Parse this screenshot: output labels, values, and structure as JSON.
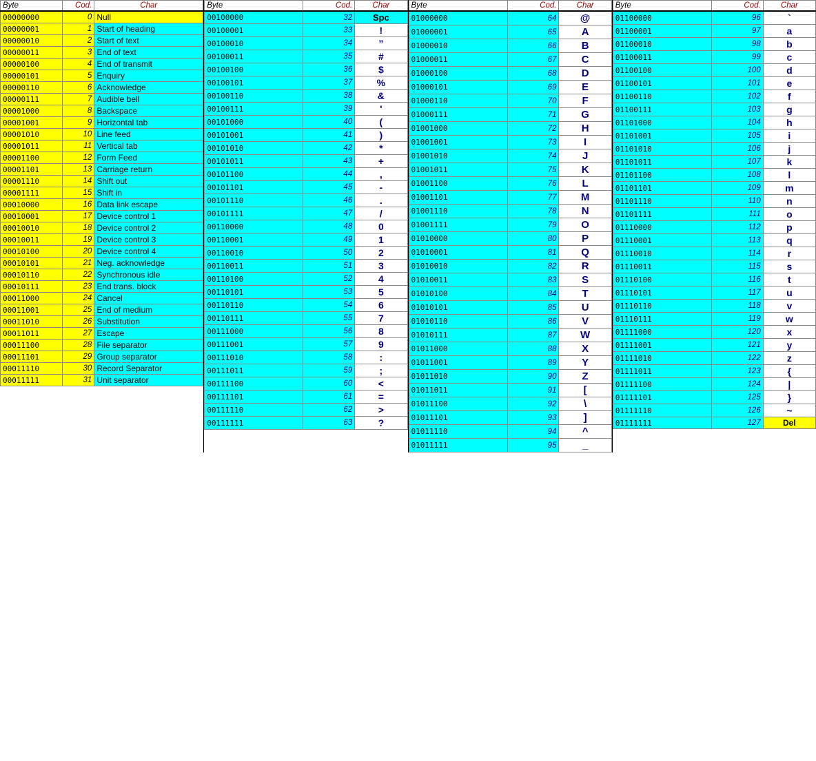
{
  "sections": [
    {
      "id": "section1",
      "headers": [
        "Byte",
        "Cod.",
        "Char"
      ],
      "rows": [
        {
          "byte": "00000000",
          "code": "0",
          "char": "Null",
          "charType": "text",
          "byteColor": "yellow",
          "descColor": "yellow"
        },
        {
          "byte": "00000001",
          "code": "1",
          "char": "Start of heading",
          "charType": "text",
          "byteColor": "yellow",
          "descColor": "cyan"
        },
        {
          "byte": "00000010",
          "code": "2",
          "char": "Start of text",
          "charType": "text",
          "byteColor": "yellow",
          "descColor": "cyan"
        },
        {
          "byte": "00000011",
          "code": "3",
          "char": "End of text",
          "charType": "text",
          "byteColor": "yellow",
          "descColor": "cyan"
        },
        {
          "byte": "00000100",
          "code": "4",
          "char": "End of transmit",
          "charType": "text",
          "byteColor": "yellow",
          "descColor": "cyan"
        },
        {
          "byte": "00000101",
          "code": "5",
          "char": "Enquiry",
          "charType": "text",
          "byteColor": "yellow",
          "descColor": "cyan"
        },
        {
          "byte": "00000110",
          "code": "6",
          "char": "Acknowledge",
          "charType": "text",
          "byteColor": "yellow",
          "descColor": "cyan"
        },
        {
          "byte": "00000111",
          "code": "7",
          "char": "Audible bell",
          "charType": "text",
          "byteColor": "yellow",
          "descColor": "cyan"
        },
        {
          "byte": "00001000",
          "code": "8",
          "char": "Backspace",
          "charType": "text",
          "byteColor": "yellow",
          "descColor": "cyan"
        },
        {
          "byte": "00001001",
          "code": "9",
          "char": "Horizontal tab",
          "charType": "text",
          "byteColor": "yellow",
          "descColor": "cyan"
        },
        {
          "byte": "00001010",
          "code": "10",
          "char": "Line feed",
          "charType": "text",
          "byteColor": "yellow",
          "descColor": "cyan"
        },
        {
          "byte": "00001011",
          "code": "11",
          "char": "Vertical tab",
          "charType": "text",
          "byteColor": "yellow",
          "descColor": "cyan"
        },
        {
          "byte": "00001100",
          "code": "12",
          "char": "Form Feed",
          "charType": "text",
          "byteColor": "yellow",
          "descColor": "cyan"
        },
        {
          "byte": "00001101",
          "code": "13",
          "char": "Carriage return",
          "charType": "text",
          "byteColor": "yellow",
          "descColor": "cyan"
        },
        {
          "byte": "00001110",
          "code": "14",
          "char": "Shift out",
          "charType": "text",
          "byteColor": "yellow",
          "descColor": "cyan"
        },
        {
          "byte": "00001111",
          "code": "15",
          "char": "Shift in",
          "charType": "text",
          "byteColor": "yellow",
          "descColor": "cyan"
        },
        {
          "byte": "00010000",
          "code": "16",
          "char": "Data link escape",
          "charType": "text",
          "byteColor": "yellow",
          "descColor": "cyan"
        },
        {
          "byte": "00010001",
          "code": "17",
          "char": "Device control 1",
          "charType": "text",
          "byteColor": "yellow",
          "descColor": "cyan"
        },
        {
          "byte": "00010010",
          "code": "18",
          "char": "Device control 2",
          "charType": "text",
          "byteColor": "yellow",
          "descColor": "cyan"
        },
        {
          "byte": "00010011",
          "code": "19",
          "char": "Device control 3",
          "charType": "text",
          "byteColor": "yellow",
          "descColor": "cyan"
        },
        {
          "byte": "00010100",
          "code": "20",
          "char": "Device control 4",
          "charType": "text",
          "byteColor": "yellow",
          "descColor": "cyan"
        },
        {
          "byte": "00010101",
          "code": "21",
          "char": "Neg. acknowledge",
          "charType": "text",
          "byteColor": "yellow",
          "descColor": "cyan"
        },
        {
          "byte": "00010110",
          "code": "22",
          "char": "Synchronous idle",
          "charType": "text",
          "byteColor": "yellow",
          "descColor": "cyan"
        },
        {
          "byte": "00010111",
          "code": "23",
          "char": "End trans. block",
          "charType": "text",
          "byteColor": "yellow",
          "descColor": "cyan"
        },
        {
          "byte": "00011000",
          "code": "24",
          "char": "Cancel",
          "charType": "text",
          "byteColor": "yellow",
          "descColor": "cyan"
        },
        {
          "byte": "00011001",
          "code": "25",
          "char": "End of medium",
          "charType": "text",
          "byteColor": "yellow",
          "descColor": "cyan"
        },
        {
          "byte": "00011010",
          "code": "26",
          "char": "Substitution",
          "charType": "text",
          "byteColor": "yellow",
          "descColor": "cyan"
        },
        {
          "byte": "00011011",
          "code": "27",
          "char": "Escape",
          "charType": "text",
          "byteColor": "yellow",
          "descColor": "cyan"
        },
        {
          "byte": "00011100",
          "code": "28",
          "char": "File separator",
          "charType": "text",
          "byteColor": "yellow",
          "descColor": "cyan"
        },
        {
          "byte": "00011101",
          "code": "29",
          "char": "Group separator",
          "charType": "text",
          "byteColor": "yellow",
          "descColor": "cyan"
        },
        {
          "byte": "00011110",
          "code": "30",
          "char": "Record Separator",
          "charType": "text",
          "byteColor": "yellow",
          "descColor": "cyan"
        },
        {
          "byte": "00011111",
          "code": "31",
          "char": "Unit separator",
          "charType": "text",
          "byteColor": "yellow",
          "descColor": "cyan"
        }
      ]
    },
    {
      "id": "section2",
      "headers": [
        "Byte",
        "Cod.",
        "Char"
      ],
      "rows": [
        {
          "byte": "00100000",
          "code": "32",
          "char": "Spc",
          "charType": "symbol",
          "byteColor": "cyan",
          "descColor": "cyan"
        },
        {
          "byte": "00100001",
          "code": "33",
          "char": "!",
          "charType": "symbol"
        },
        {
          "byte": "00100010",
          "code": "34",
          "char": "”",
          "charType": "symbol"
        },
        {
          "byte": "00100011",
          "code": "35",
          "char": "#",
          "charType": "symbol"
        },
        {
          "byte": "00100100",
          "code": "36",
          "char": "$",
          "charType": "symbol"
        },
        {
          "byte": "00100101",
          "code": "37",
          "char": "%",
          "charType": "symbol"
        },
        {
          "byte": "00100110",
          "code": "38",
          "char": "&",
          "charType": "symbol"
        },
        {
          "byte": "00100111",
          "code": "39",
          "char": "'",
          "charType": "symbol"
        },
        {
          "byte": "00101000",
          "code": "40",
          "char": "(",
          "charType": "symbol"
        },
        {
          "byte": "00101001",
          "code": "41",
          "char": ")",
          "charType": "symbol"
        },
        {
          "byte": "00101010",
          "code": "42",
          "char": "*",
          "charType": "symbol"
        },
        {
          "byte": "00101011",
          "code": "43",
          "char": "+",
          "charType": "symbol"
        },
        {
          "byte": "00101100",
          "code": "44",
          "char": ",",
          "charType": "symbol"
        },
        {
          "byte": "00101101",
          "code": "45",
          "char": "-",
          "charType": "symbol"
        },
        {
          "byte": "00101110",
          "code": "46",
          "char": ".",
          "charType": "symbol"
        },
        {
          "byte": "00101111",
          "code": "47",
          "char": "/",
          "charType": "symbol"
        },
        {
          "byte": "00110000",
          "code": "48",
          "char": "0",
          "charType": "symbol"
        },
        {
          "byte": "00110001",
          "code": "49",
          "char": "1",
          "charType": "symbol"
        },
        {
          "byte": "00110010",
          "code": "50",
          "char": "2",
          "charType": "symbol"
        },
        {
          "byte": "00110011",
          "code": "51",
          "char": "3",
          "charType": "symbol"
        },
        {
          "byte": "00110100",
          "code": "52",
          "char": "4",
          "charType": "symbol"
        },
        {
          "byte": "00110101",
          "code": "53",
          "char": "5",
          "charType": "symbol"
        },
        {
          "byte": "00110110",
          "code": "54",
          "char": "6",
          "charType": "symbol"
        },
        {
          "byte": "00110111",
          "code": "55",
          "char": "7",
          "charType": "symbol"
        },
        {
          "byte": "00111000",
          "code": "56",
          "char": "8",
          "charType": "symbol"
        },
        {
          "byte": "00111001",
          "code": "57",
          "char": "9",
          "charType": "symbol"
        },
        {
          "byte": "00111010",
          "code": "58",
          "char": ":",
          "charType": "symbol"
        },
        {
          "byte": "00111011",
          "code": "59",
          "char": ";",
          "charType": "symbol"
        },
        {
          "byte": "00111100",
          "code": "60",
          "char": "<",
          "charType": "symbol"
        },
        {
          "byte": "00111101",
          "code": "61",
          "char": "=",
          "charType": "symbol"
        },
        {
          "byte": "00111110",
          "code": "62",
          "char": ">",
          "charType": "symbol"
        },
        {
          "byte": "00111111",
          "code": "63",
          "char": "?",
          "charType": "symbol"
        }
      ]
    },
    {
      "id": "section3",
      "headers": [
        "Byte",
        "Cod.",
        "Char"
      ],
      "rows": [
        {
          "byte": "01000000",
          "code": "64",
          "char": "@"
        },
        {
          "byte": "01000001",
          "code": "65",
          "char": "A"
        },
        {
          "byte": "01000010",
          "code": "66",
          "char": "B"
        },
        {
          "byte": "01000011",
          "code": "67",
          "char": "C"
        },
        {
          "byte": "01000100",
          "code": "68",
          "char": "D"
        },
        {
          "byte": "01000101",
          "code": "69",
          "char": "E"
        },
        {
          "byte": "01000110",
          "code": "70",
          "char": "F"
        },
        {
          "byte": "01000111",
          "code": "71",
          "char": "G"
        },
        {
          "byte": "01001000",
          "code": "72",
          "char": "H"
        },
        {
          "byte": "01001001",
          "code": "73",
          "char": "I"
        },
        {
          "byte": "01001010",
          "code": "74",
          "char": "J"
        },
        {
          "byte": "01001011",
          "code": "75",
          "char": "K"
        },
        {
          "byte": "01001100",
          "code": "76",
          "char": "L"
        },
        {
          "byte": "01001101",
          "code": "77",
          "char": "M"
        },
        {
          "byte": "01001110",
          "code": "78",
          "char": "N"
        },
        {
          "byte": "01001111",
          "code": "79",
          "char": "O"
        },
        {
          "byte": "01010000",
          "code": "80",
          "char": "P"
        },
        {
          "byte": "01010001",
          "code": "81",
          "char": "Q"
        },
        {
          "byte": "01010010",
          "code": "82",
          "char": "R"
        },
        {
          "byte": "01010011",
          "code": "83",
          "char": "S"
        },
        {
          "byte": "01010100",
          "code": "84",
          "char": "T"
        },
        {
          "byte": "01010101",
          "code": "85",
          "char": "U"
        },
        {
          "byte": "01010110",
          "code": "86",
          "char": "V"
        },
        {
          "byte": "01010111",
          "code": "87",
          "char": "W"
        },
        {
          "byte": "01011000",
          "code": "88",
          "char": "X"
        },
        {
          "byte": "01011001",
          "code": "89",
          "char": "Y"
        },
        {
          "byte": "01011010",
          "code": "90",
          "char": "Z"
        },
        {
          "byte": "01011011",
          "code": "91",
          "char": "["
        },
        {
          "byte": "01011100",
          "code": "92",
          "char": "\\"
        },
        {
          "byte": "01011101",
          "code": "93",
          "char": "]"
        },
        {
          "byte": "01011110",
          "code": "94",
          "char": "^"
        },
        {
          "byte": "01011111",
          "code": "95",
          "char": "_"
        }
      ]
    },
    {
      "id": "section4",
      "headers": [
        "Byte",
        "Cod.",
        "Char"
      ],
      "rows": [
        {
          "byte": "01100000",
          "code": "96",
          "char": "`"
        },
        {
          "byte": "01100001",
          "code": "97",
          "char": "a"
        },
        {
          "byte": "01100010",
          "code": "98",
          "char": "b"
        },
        {
          "byte": "01100011",
          "code": "99",
          "char": "c"
        },
        {
          "byte": "01100100",
          "code": "100",
          "char": "d"
        },
        {
          "byte": "01100101",
          "code": "101",
          "char": "e"
        },
        {
          "byte": "01100110",
          "code": "102",
          "char": "f"
        },
        {
          "byte": "01100111",
          "code": "103",
          "char": "g"
        },
        {
          "byte": "01101000",
          "code": "104",
          "char": "h"
        },
        {
          "byte": "01101001",
          "code": "105",
          "char": "i"
        },
        {
          "byte": "01101010",
          "code": "106",
          "char": "j"
        },
        {
          "byte": "01101011",
          "code": "107",
          "char": "k"
        },
        {
          "byte": "01101100",
          "code": "108",
          "char": "l"
        },
        {
          "byte": "01101101",
          "code": "109",
          "char": "m"
        },
        {
          "byte": "01101110",
          "code": "110",
          "char": "n"
        },
        {
          "byte": "01101111",
          "code": "111",
          "char": "o"
        },
        {
          "byte": "01110000",
          "code": "112",
          "char": "p"
        },
        {
          "byte": "01110001",
          "code": "113",
          "char": "q"
        },
        {
          "byte": "01110010",
          "code": "114",
          "char": "r"
        },
        {
          "byte": "01110011",
          "code": "115",
          "char": "s"
        },
        {
          "byte": "01110100",
          "code": "116",
          "char": "t"
        },
        {
          "byte": "01110101",
          "code": "117",
          "char": "u"
        },
        {
          "byte": "01110110",
          "code": "118",
          "char": "v"
        },
        {
          "byte": "01110111",
          "code": "119",
          "char": "w"
        },
        {
          "byte": "01111000",
          "code": "120",
          "char": "x"
        },
        {
          "byte": "01111001",
          "code": "121",
          "char": "y"
        },
        {
          "byte": "01111010",
          "code": "122",
          "char": "z"
        },
        {
          "byte": "01111011",
          "code": "123",
          "char": "{"
        },
        {
          "byte": "01111100",
          "code": "124",
          "char": "|"
        },
        {
          "byte": "01111101",
          "code": "125",
          "char": "}"
        },
        {
          "byte": "01111110",
          "code": "126",
          "char": "~"
        },
        {
          "byte": "01111111",
          "code": "127",
          "char": "Del"
        }
      ]
    }
  ]
}
